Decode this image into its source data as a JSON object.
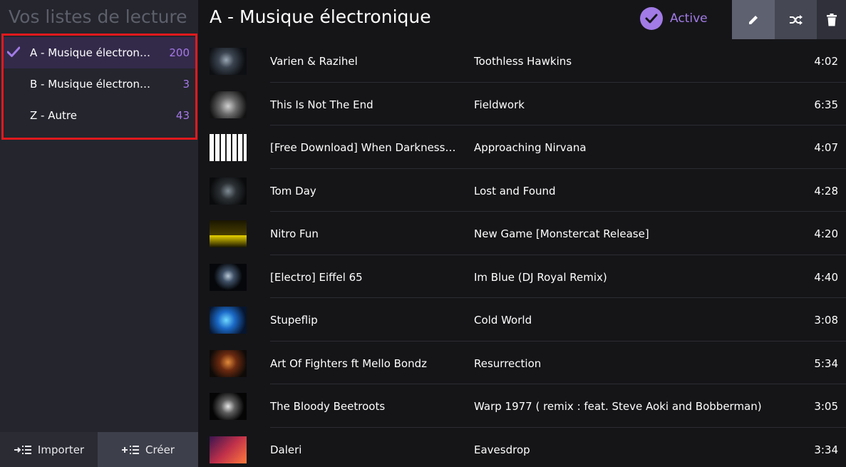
{
  "sidebar": {
    "title": "Vos listes de lecture",
    "playlists": [
      {
        "name": "A - Musique électronique",
        "count": "200",
        "active": true
      },
      {
        "name": "B - Musique électronique",
        "count": "3",
        "active": false
      },
      {
        "name": "Z - Autre",
        "count": "43",
        "active": false
      }
    ],
    "import_label": "Importer",
    "create_label": "Créer"
  },
  "header": {
    "title": "A - Musique électronique",
    "active_label": "Active"
  },
  "colors": {
    "accent": "#a27be6",
    "highlight_border": "#e0191d"
  },
  "tracks": [
    {
      "artist": "Varien & Razihel",
      "title": "Toothless Hawkins",
      "duration": "4:02",
      "thumb": "dark-dragon-art"
    },
    {
      "artist": "This Is Not The End",
      "title": "Fieldwork",
      "duration": "6:35",
      "thumb": "grey-abstract"
    },
    {
      "artist": "[Free Download] When Darkness Comes",
      "title": "Approaching Nirvana",
      "duration": "4:07",
      "thumb": "green-piano-keys"
    },
    {
      "artist": "Tom Day",
      "title": "Lost and Found",
      "duration": "4:28",
      "thumb": "dark-figure"
    },
    {
      "artist": "Nitro Fun",
      "title": "New Game [Monstercat Release]",
      "duration": "4:20",
      "thumb": "nitro-fun-logo"
    },
    {
      "artist": "[Electro] Eiffel 65",
      "title": "Im Blue (DJ Royal Remix)",
      "duration": "4:40",
      "thumb": "blue-visualizer"
    },
    {
      "artist": "Stupeflip",
      "title": "Cold World",
      "duration": "3:08",
      "thumb": "blue-glow"
    },
    {
      "artist": "Art Of Fighters ft Mello Bondz",
      "title": "Resurrection",
      "duration": "5:34",
      "thumb": "orange-cover"
    },
    {
      "artist": "The Bloody Beetroots",
      "title": "Warp 1977 ( remix : feat. Steve Aoki and Bobberman)",
      "duration": "3:05",
      "thumb": "skull-cover"
    },
    {
      "artist": "Daleri",
      "title": "Eavesdrop",
      "duration": "3:34",
      "thumb": "red-purple-art"
    }
  ]
}
